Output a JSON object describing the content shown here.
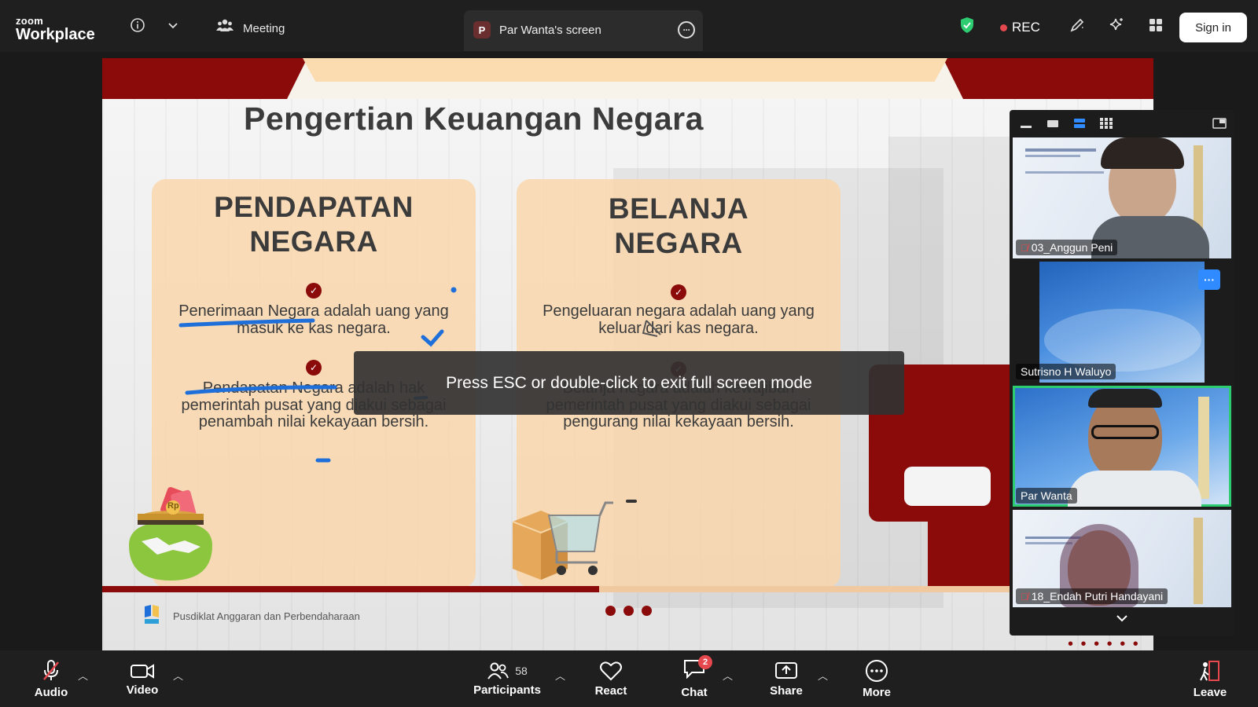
{
  "topbar": {
    "logo_line1": "zoom",
    "logo_line2": "Workplace",
    "meeting_label": "Meeting",
    "screen_badge": "P",
    "screen_label": "Par Wanta's screen",
    "rec_label": "REC",
    "signin_label": "Sign in"
  },
  "slide": {
    "title": "Pengertian Keuangan Negara",
    "card_left": {
      "heading_line1": "PENDAPATAN",
      "heading_line2": "NEGARA",
      "point1": "Penerimaan Negara adalah uang yang masuk ke kas negara.",
      "point2": "Pendapatan Negara adalah hak pemerintah pusat yang diakui sebagai penambah nilai kekayaan bersih."
    },
    "card_right": {
      "heading_line1": "BELANJA",
      "heading_line2": "NEGARA",
      "point1": "Pengeluaran negara adalah uang yang keluar dari kas negara.",
      "point2": "Belanja negara adalah kewajiban pemerintah pusat yang diakui sebagai pengurang nilai kekayaan bersih."
    },
    "coin_label": "Rp",
    "footer_text": "Pusdiklat Anggaran dan Perbendaharaan",
    "esc_message": "Press ESC or double-click to exit full screen mode"
  },
  "video_tiles": [
    {
      "name": "03_Anggun Peni",
      "muted": true
    },
    {
      "name": "Sutrisno H Waluyo",
      "muted": false
    },
    {
      "name": "Par Wanta",
      "muted": false,
      "active": true
    },
    {
      "name": "18_Endah Putri Handayani",
      "muted": true
    }
  ],
  "bottombar": {
    "audio": "Audio",
    "video": "Video",
    "participants": "Participants",
    "participants_count": "58",
    "react": "React",
    "chat": "Chat",
    "chat_badge": "2",
    "share": "Share",
    "more": "More",
    "leave": "Leave"
  },
  "colors": {
    "brand_red": "#8b0a0a",
    "card_peach": "#fad6aa",
    "active_speaker": "#2ecc71",
    "rec_dot": "#e5484d"
  }
}
